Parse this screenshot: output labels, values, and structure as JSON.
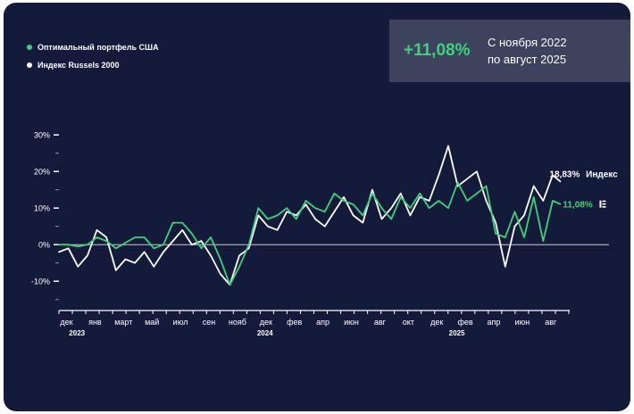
{
  "legend": [
    {
      "label": "Оптимальный портфель США",
      "color": "#3ed17c"
    },
    {
      "label": "Индекс Russels 2000",
      "color": "#ffffff"
    }
  ],
  "summary": {
    "value": "+11,08%",
    "period_line1": "С ноября 2022",
    "period_line2": "по август 2025"
  },
  "end_labels": {
    "index_value": "18,83%",
    "index_name": "Индекс",
    "portfolio_value": "11,08%"
  },
  "colors": {
    "background": "#141a3a",
    "portfolio": "#3ed17c",
    "index": "#ffffff",
    "summary_box": "#3d435d"
  },
  "chart_data": {
    "type": "line",
    "ylim": [
      -18,
      32
    ],
    "yticks": [
      30,
      20,
      10,
      0,
      -10
    ],
    "ytick_labels": [
      "30%",
      "20%",
      "10%",
      "0%",
      "-10%"
    ],
    "xticks": [
      {
        "label": "дек",
        "year": "2023",
        "pos": 0.4
      },
      {
        "label": "янв",
        "year": "",
        "pos": 1.9
      },
      {
        "label": "март",
        "year": "",
        "pos": 3.4
      },
      {
        "label": "май",
        "year": "",
        "pos": 4.9
      },
      {
        "label": "июл",
        "year": "",
        "pos": 6.4
      },
      {
        "label": "сен",
        "year": "",
        "pos": 7.9
      },
      {
        "label": "нояб",
        "year": "",
        "pos": 9.4
      },
      {
        "label": "дек",
        "year": "2024",
        "pos": 10.9
      },
      {
        "label": "фев",
        "year": "",
        "pos": 12.4
      },
      {
        "label": "апр",
        "year": "",
        "pos": 13.9
      },
      {
        "label": "июн",
        "year": "",
        "pos": 15.4
      },
      {
        "label": "авг",
        "year": "",
        "pos": 16.9
      },
      {
        "label": "окт",
        "year": "",
        "pos": 18.4
      },
      {
        "label": "дек",
        "year": "2025",
        "pos": 19.9
      },
      {
        "label": "фев",
        "year": "",
        "pos": 21.4
      },
      {
        "label": "апр",
        "year": "",
        "pos": 22.9
      },
      {
        "label": "июн",
        "year": "",
        "pos": 24.4
      },
      {
        "label": "авг",
        "year": "",
        "pos": 25.9
      }
    ],
    "year_labels": [
      {
        "label": "2023",
        "pos": 0.95
      },
      {
        "label": "2024",
        "pos": 10.85
      },
      {
        "label": "2025",
        "pos": 20.95
      }
    ],
    "x_range": [
      0,
      26.85
    ],
    "series": [
      {
        "name": "Оптимальный портфель США",
        "color": "#3ed17c",
        "x": [
          0,
          0.5,
          1,
          1.5,
          2,
          2.5,
          3,
          3.5,
          4,
          4.5,
          5,
          5.5,
          6,
          6.5,
          7,
          7.5,
          8,
          8.5,
          9,
          9.5,
          10,
          10.5,
          11,
          11.5,
          12,
          12.5,
          13,
          13.5,
          14,
          14.5,
          15,
          15.5,
          16,
          16.5,
          17,
          17.5,
          18,
          18.5,
          19,
          19.5,
          20,
          20.5,
          21,
          21.5,
          22,
          22.5,
          23,
          23.5,
          24,
          24.5,
          25,
          25.5,
          26,
          26.4
        ],
        "values": [
          0,
          0,
          -0.5,
          0,
          2,
          1,
          -1,
          0.5,
          2,
          2,
          -1,
          0,
          6,
          6,
          3,
          -1,
          2,
          -4,
          -11,
          -6,
          0,
          10,
          7,
          8,
          10,
          7,
          12,
          10,
          9,
          14,
          12,
          11,
          8,
          14,
          10,
          7,
          13,
          10,
          14,
          10,
          12,
          10,
          17,
          12,
          14,
          16,
          3,
          2,
          9,
          2,
          13,
          1,
          12,
          11.1
        ]
      },
      {
        "name": "Индекс Russels 2000",
        "color": "#ffffff",
        "x": [
          0,
          0.5,
          1,
          1.5,
          2,
          2.5,
          3,
          3.5,
          4,
          4.5,
          5,
          5.5,
          6,
          6.5,
          7,
          7.5,
          8,
          8.5,
          9,
          9.5,
          10,
          10.5,
          11,
          11.5,
          12,
          12.5,
          13,
          13.5,
          14,
          14.5,
          15,
          15.5,
          16,
          16.5,
          17,
          17.5,
          18,
          18.5,
          19,
          19.5,
          20,
          20.5,
          21,
          21.5,
          22,
          22.5,
          23,
          23.5,
          24,
          24.5,
          25,
          25.5,
          26,
          26.4
        ],
        "values": [
          -2,
          -1,
          -6,
          -3,
          4,
          2,
          -7,
          -4,
          -5,
          -2,
          -6,
          -2,
          1,
          4,
          0,
          1,
          -3,
          -8,
          -11,
          -3,
          -1,
          8,
          5,
          4,
          9,
          8,
          11,
          7,
          5,
          9,
          13,
          8,
          6,
          15,
          7,
          10,
          14,
          8,
          13,
          12,
          19,
          27,
          16,
          18,
          20,
          12,
          6,
          -6,
          5,
          8,
          16,
          12,
          19,
          17.3
        ]
      }
    ]
  }
}
